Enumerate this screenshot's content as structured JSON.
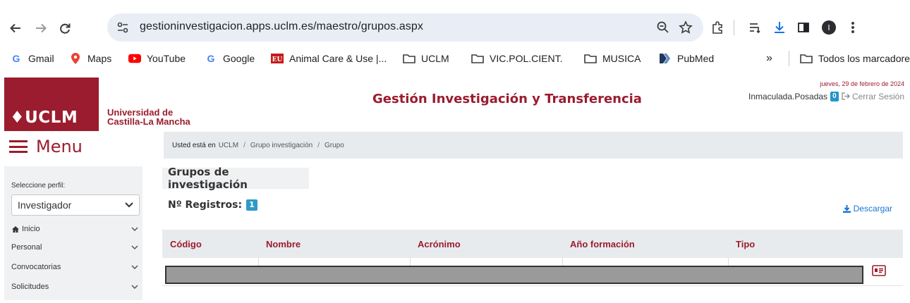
{
  "browser": {
    "url": "gestioninvestigacion.apps.uclm.es/maestro/grupos.aspx",
    "bookmarks": [
      {
        "label": "Gmail",
        "icon": "google-g-icon"
      },
      {
        "label": "Maps",
        "icon": "maps-pin-icon"
      },
      {
        "label": "YouTube",
        "icon": "youtube-icon"
      },
      {
        "label": "Google",
        "icon": "google-g-icon"
      },
      {
        "label": "Animal Care & Use |...",
        "icon": "eu-icon"
      },
      {
        "label": "UCLM",
        "icon": "folder-icon"
      },
      {
        "label": "VIC.POL.CIENT.",
        "icon": "folder-icon"
      },
      {
        "label": "MUSICA",
        "icon": "folder-icon"
      },
      {
        "label": "PubMed",
        "icon": "pubmed-icon"
      }
    ],
    "overflow_label": "»",
    "all_bookmarks_label": "Todos los marcadore",
    "profile_initial": "I"
  },
  "header": {
    "logo_text": "♦UCLM",
    "university_line1": "Universidad de",
    "university_line2": "Castilla-La Mancha",
    "app_title": "Gestión Investigación y Transferencia",
    "date": "jueves, 29 de febrero de 2024",
    "username": "Inmaculada.Posadas",
    "user_badge": "0",
    "logout_label": "Cerrar Sesión"
  },
  "menu": {
    "label": "Menu"
  },
  "breadcrumb": {
    "prefix": "Usted está en",
    "items": [
      "UCLM",
      "Grupo investigación",
      "Grupo"
    ]
  },
  "sidebar": {
    "profile_label": "Seleccione perfil:",
    "profile_value": "Investigador",
    "items": [
      {
        "label": "Inicio"
      },
      {
        "label": "Personal"
      },
      {
        "label": "Convocatorias"
      },
      {
        "label": "Solicitudes"
      }
    ]
  },
  "main": {
    "section_title": "Grupos de investigación",
    "records_label": "Nº Registros:",
    "records_count": "1",
    "download_label": "Descargar",
    "table": {
      "columns": [
        "Código",
        "Nombre",
        "Acrónimo",
        "Año formación",
        "Tipo"
      ]
    }
  },
  "colors": {
    "brand": "#9b1c2e",
    "link": "#1976d2",
    "badge": "#2e9bc6",
    "panel": "#e8ebee"
  }
}
